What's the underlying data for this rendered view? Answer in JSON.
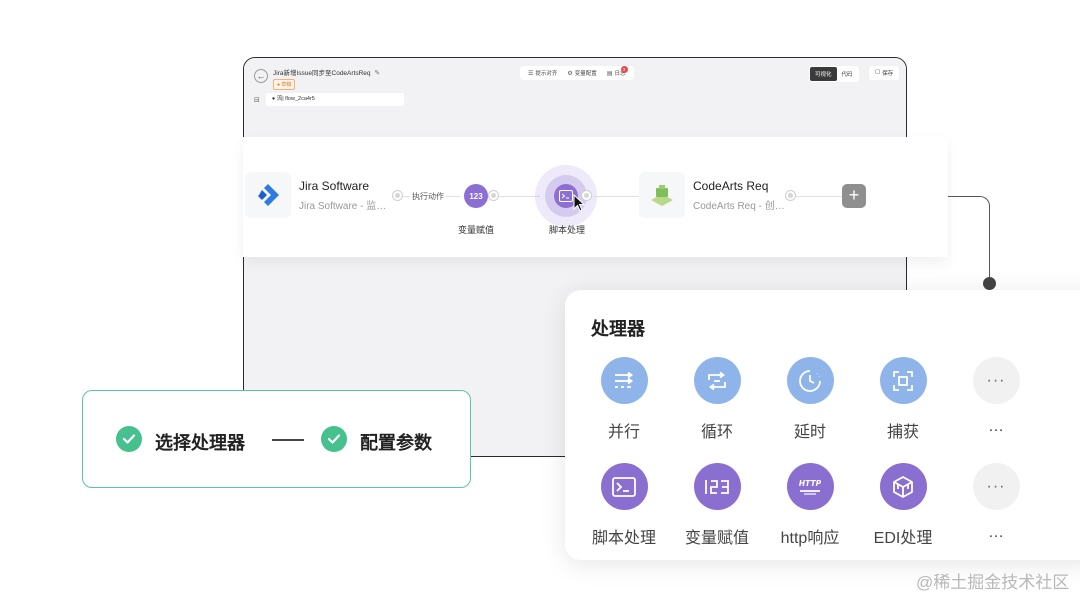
{
  "window": {
    "title": "Jira新增Issue同步至CodeArtsReq",
    "status_tag": "● 草稿",
    "toolbar": [
      {
        "icon": "list-icon",
        "label": "提示对齐"
      },
      {
        "icon": "gear-icon",
        "label": "变量配置"
      },
      {
        "icon": "log-icon",
        "label": "日志",
        "badge": "3"
      }
    ],
    "mode_options": [
      "可视化",
      "代码"
    ],
    "active_mode": "可视化",
    "save_label": "保存",
    "flow_name": "● 流| flow_2ca4r5"
  },
  "flow": {
    "trigger": {
      "title": "Jira Software",
      "subtitle": "Jira Software - 监…"
    },
    "action_label": "执行动作",
    "variable_node": {
      "glyph": "123",
      "label": "变量赋值"
    },
    "script_node": {
      "label": "脚本处理"
    },
    "target": {
      "title": "CodeArts Req",
      "subtitle": "CodeArts Req - 创…"
    },
    "add_button": "+"
  },
  "panel": {
    "title": "处理器",
    "row1": [
      {
        "label": "并行",
        "icon": "parallel-icon",
        "color": "blue"
      },
      {
        "label": "循环",
        "icon": "loop-icon",
        "color": "blue"
      },
      {
        "label": "延时",
        "icon": "clock-icon",
        "color": "blue"
      },
      {
        "label": "捕获",
        "icon": "capture-icon",
        "color": "blue"
      },
      {
        "label": "…",
        "icon": "more-icon",
        "color": "gray"
      }
    ],
    "row2": [
      {
        "label": "脚本处理",
        "icon": "terminal-icon",
        "color": "purple"
      },
      {
        "label": "变量赋值",
        "icon": "number-icon",
        "color": "purple"
      },
      {
        "label": "http响应",
        "icon": "http-icon",
        "color": "purple"
      },
      {
        "label": "EDI处理",
        "icon": "cube-icon",
        "color": "purple"
      },
      {
        "label": "…",
        "icon": "more-icon",
        "color": "gray"
      }
    ],
    "more_glyph": "···"
  },
  "steps": {
    "step1": "选择处理器",
    "step2": "配置参数"
  },
  "colors": {
    "accent_purple": "#8b6fd0",
    "accent_blue": "#8fb4ea",
    "step_green": "#46c08f",
    "step_border": "#5cc4a0"
  },
  "watermark": "@稀土掘金技术社区"
}
